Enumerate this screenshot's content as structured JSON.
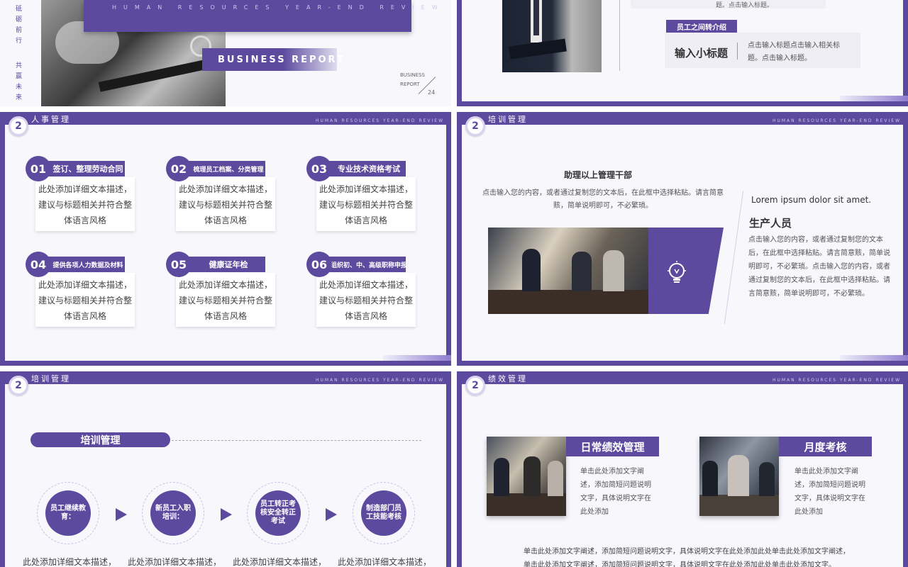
{
  "slide1": {
    "side_text_1": "砥砺前行",
    "side_text_2": "共赢未来",
    "header_sub": "HUMAN RESOURCES YEAR-END REVIEW",
    "business_report": "BUSINESS REPORT",
    "corner_label_1": "BUSINESS",
    "corner_label_2": "REPORT",
    "corner_num": "24"
  },
  "slide2": {
    "top_text": "题。点击输入标题。",
    "tag": "员工之间转介绍",
    "subtitle": "输入小标题",
    "desc": "点击输入标题点击输入相关标题。点击输入标题。"
  },
  "slide3": {
    "badge": "2",
    "section_title": "人事管理",
    "section_sub": "HUMAN RESOURCES YEAR-END REVIEW",
    "items": [
      {
        "num": "01",
        "label": "签订、整理劳动合同",
        "text": "此处添加详细文本描述，建议与标题相关并符合整体语言风格"
      },
      {
        "num": "02",
        "label": "梳理员工档案、分类管理",
        "text": "此处添加详细文本描述，建议与标题相关并符合整体语言风格"
      },
      {
        "num": "03",
        "label": "专业技术资格考试",
        "text": "此处添加详细文本描述，建议与标题相关并符合整体语言风格"
      },
      {
        "num": "04",
        "label": "提供各项人力数据及材料",
        "text": "此处添加详细文本描述，建议与标题相关并符合整体语言风格"
      },
      {
        "num": "05",
        "label": "健康证年检",
        "text": "此处添加详细文本描述，建议与标题相关并符合整体语言风格"
      },
      {
        "num": "06",
        "label": "组织初、中、高级职称申报",
        "text": "此处添加详细文本描述，建议与标题相关并符合整体语言风格"
      }
    ]
  },
  "slide4": {
    "badge": "2",
    "section_title": "培训管理",
    "section_sub": "HUMAN RESOURCES YEAR-END REVIEW",
    "left_title": "助理以上管理干部",
    "left_desc": "点击输入您的内容，或者通过复制您的文本后，在此框中选择粘贴。请言简意赅，简单说明即可，不必繁琐。",
    "lorem": "Lorem ipsum dolor sit amet.",
    "right_title": "生产人员",
    "right_desc": "点击输入您的内容，或者通过复制您的文本后，在此框中选择粘贴。请言简意赅，简单说明即可，不必繁琐。点击输入您的内容，或者通过复制您的文本后，在此框中选择粘贴。请言简意赅，简单说明即可，不必繁琐。",
    "icon": "lightbulb-icon"
  },
  "slide5": {
    "badge": "2",
    "section_title": "培训管理",
    "section_sub": "HUMAN RESOURCES YEAR-END REVIEW",
    "pill": "培训管理",
    "steps": [
      {
        "label": "员工继续教育：",
        "desc": "此处添加详细文本描述，"
      },
      {
        "label": "新员工入职培训：",
        "desc": "此处添加详细文本描述，"
      },
      {
        "label": "员工转正考核安全转正考试",
        "desc": "此处添加详细文本描述，"
      },
      {
        "label": "制造部门员工技能考核",
        "desc": "此处添加详细文本描述，"
      }
    ]
  },
  "slide6": {
    "badge": "2",
    "section_title": "绩效管理",
    "section_sub": "HUMAN RESOURCES YEAR-END REVIEW",
    "card1_title": "日常绩效管理",
    "card1_desc": "单击此处添加文字阐述，添加简短问题说明文字，具体说明文字在此处添加",
    "card2_title": "月度考核",
    "card2_desc": "单击此处添加文字阐述，添加简短问题说明文字，具体说明文字在此处添加",
    "bottom_line1": "单击此处添加文字阐述，添加简短问题说明文字，具体说明文字在此处添加此处单击此处添加文字阐述，",
    "bottom_line2": "单击此处添加文字阐述，添加简短问题说明文字，具体说明文字在此处添加此处单击此处添加文字。"
  },
  "colors": {
    "accent": "#5b4a9e",
    "light": "#f7f7fc"
  }
}
